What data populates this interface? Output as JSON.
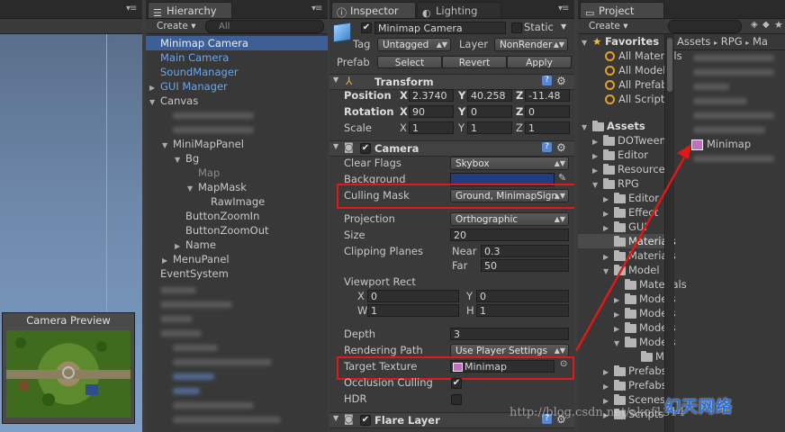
{
  "scene": {
    "menu_glyph": "▾≡"
  },
  "hierarchy": {
    "tab": "Hierarchy",
    "create": "Create ▾",
    "search_placeholder": "All",
    "items": {
      "minimap_camera": "Minimap Camera",
      "main_camera": "Main Camera",
      "sound_manager": "SoundManager",
      "gui_manager": "GUI Manager",
      "canvas": "Canvas",
      "minimap_panel": "MiniMapPanel",
      "bg": "Bg",
      "map": "Map",
      "map_mask": "MapMask",
      "raw_image": "RawImage",
      "zoom_in": "ButtonZoomIn",
      "zoom_out": "ButtonZoomOut",
      "name": "Name",
      "menu_panel": "MenuPanel",
      "event_system": "EventSystem"
    }
  },
  "camera_preview": {
    "title": "Camera Preview"
  },
  "inspector": {
    "tab": "Inspector",
    "lighting_tab": "Lighting",
    "object_name": "Minimap Camera",
    "static_label": "Static",
    "tag_label": "Tag",
    "tag_value": "Untagged",
    "layer_label": "Layer",
    "layer_value": "NonRender",
    "prefab_label": "Prefab",
    "prefab_select": "Select",
    "prefab_revert": "Revert",
    "prefab_apply": "Apply",
    "transform": {
      "title": "Transform",
      "position_label": "Position",
      "rotation_label": "Rotation",
      "scale_label": "Scale",
      "x": "X",
      "y": "Y",
      "z": "Z",
      "pos_x": "2.3740",
      "pos_y": "40.258",
      "pos_z": "-11.48",
      "rot_x": "90",
      "rot_y": "0",
      "rot_z": "0",
      "scl_x": "1",
      "scl_y": "1",
      "scl_z": "1"
    },
    "camera": {
      "title": "Camera",
      "clear_flags_label": "Clear Flags",
      "clear_flags_value": "Skybox",
      "background_label": "Background",
      "background_color": "#1f3d80",
      "culling_mask_label": "Culling Mask",
      "culling_mask_value": "Ground, MinimapSign",
      "projection_label": "Projection",
      "projection_value": "Orthographic",
      "size_label": "Size",
      "size_value": "20",
      "clipping_label": "Clipping Planes",
      "near_label": "Near",
      "near_value": "0.3",
      "far_label": "Far",
      "far_value": "50",
      "viewport_label": "Viewport Rect",
      "vx_label": "X",
      "vx_value": "0",
      "vy_label": "Y",
      "vy_value": "0",
      "vw_label": "W",
      "vw_value": "1",
      "vh_label": "H",
      "vh_value": "1",
      "depth_label": "Depth",
      "depth_value": "3",
      "rendering_path_label": "Rendering Path",
      "rendering_path_value": "Use Player Settings",
      "target_texture_label": "Target Texture",
      "target_texture_value": "Minimap",
      "occlusion_label": "Occlusion Culling",
      "hdr_label": "HDR"
    },
    "flare_layer": {
      "title": "Flare Layer"
    }
  },
  "project": {
    "tab": "Project",
    "create": "Create ▾",
    "favorites_title": "Favorites",
    "favorites": [
      "All Materials",
      "All Models",
      "All Prefabs",
      "All Scripts"
    ],
    "assets_title": "Assets",
    "assets": [
      "DOTween",
      "Editor",
      "Resources",
      "RPG"
    ],
    "rpg_children": [
      "Editor",
      "Effect",
      "GUI",
      "Materials",
      "Materials",
      "Model"
    ],
    "model_children": [
      "Materials",
      "Models",
      "Models",
      "Models",
      "Models"
    ],
    "model_sub": "M",
    "more_folders": [
      "Prefabs",
      "Prefabs",
      "Scenes",
      "Scripts"
    ],
    "breadcrumb": [
      "Assets",
      "RPG",
      "Ma"
    ],
    "breadcrumb_sep": "▸",
    "minimap_asset": "Minimap"
  },
  "watermark": "http://blog.csdn.net/akof1314",
  "logo_text": "幻天网络"
}
